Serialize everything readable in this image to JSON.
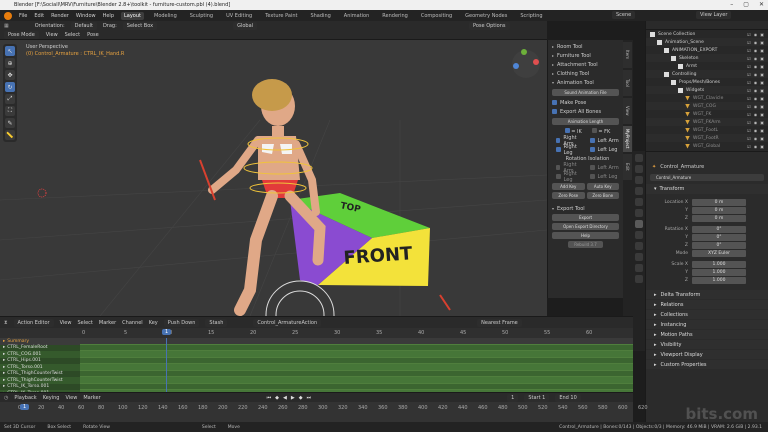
{
  "window": {
    "title": "Blender [F:\\Sociall\\MRV\\Furniture\\Blender 2.8+\\toolkit - furniture-custom.pbl (4).blend]"
  },
  "menu": [
    "File",
    "Edit",
    "Render",
    "Window",
    "Help"
  ],
  "workspaces": [
    "Layout",
    "Modeling",
    "Sculpting",
    "UV Editing",
    "Texture Paint",
    "Shading",
    "Animation",
    "Rendering",
    "Compositing",
    "Geometry Nodes",
    "Scripting"
  ],
  "active_workspace": "Layout",
  "scene": {
    "label": "Scene",
    "view_layer": "View Layer"
  },
  "viewport_header": {
    "mode": "Pose Mode",
    "view": "View",
    "select": "Select",
    "pose": "Pose",
    "orientation_label": "Orientation:",
    "orientation": "Default",
    "drag_label": "Drag:",
    "drag": "Select Box",
    "global": "Global",
    "pose_options": "Pose Options"
  },
  "viewport": {
    "perspective": "User Perspective",
    "object": "(0) Control_Armature : CTRL_IK_Hand.R",
    "box_front": "FRONT",
    "box_top": "TOP"
  },
  "npanel": {
    "tools": [
      "Room Tool",
      "Furniture Tool",
      "Attachment Tool",
      "Clothing Tool",
      "Animation Tool"
    ],
    "anim_field": "Sound Animation File",
    "make_pose": "Make Pose",
    "export_all_bones": "Export All Bones",
    "anim_length": "Animation Length",
    "ik_label": "= IK",
    "fk_label": "= FK",
    "limbs": [
      "Right Arm",
      "Left Arm",
      "Right Leg",
      "Left Leg"
    ],
    "rotation_isolation": "Rotation Isolation",
    "rot_limbs": [
      "Right Arm",
      "Left Arm",
      "Right Leg",
      "Left Leg"
    ],
    "key_buttons": [
      "Add Key",
      "Auto Key",
      "Zero Pose",
      "Zero Bone"
    ],
    "export_tool": "Export Tool",
    "export_buttons": [
      "Export",
      "Open Export Directory",
      "Help",
      "Rebuild 3.7"
    ]
  },
  "ntabs": [
    "Item",
    "Tool",
    "View",
    "MyProject",
    "Edit",
    "Edit"
  ],
  "outliner": {
    "rows": [
      {
        "name": "Scene Collection",
        "indent": 0,
        "color": "#cfcfcf"
      },
      {
        "name": "Animation_Scene",
        "indent": 1,
        "color": "#cfcfcf"
      },
      {
        "name": "ANIMATION_EXPORT",
        "indent": 2,
        "color": "#cfcfcf"
      },
      {
        "name": "Skeleton",
        "indent": 3,
        "color": "#cfcfcf"
      },
      {
        "name": "Armt",
        "indent": 4,
        "color": "#cfcfcf"
      },
      {
        "name": "Controlling",
        "indent": 2,
        "color": "#cfcfcf"
      },
      {
        "name": "Props/Mesh/Bones",
        "indent": 3,
        "color": "#cfcfcf"
      },
      {
        "name": "Widgets",
        "indent": 4,
        "color": "#cfcfcf"
      },
      {
        "name": "WGT_Clavicle",
        "indent": 5,
        "color": "#8f8f8f"
      },
      {
        "name": "WGT_COG",
        "indent": 5,
        "color": "#8f8f8f"
      },
      {
        "name": "WGT_FK",
        "indent": 5,
        "color": "#8f8f8f"
      },
      {
        "name": "WGT_FKArm",
        "indent": 5,
        "color": "#8f8f8f"
      },
      {
        "name": "WGT_FootL",
        "indent": 5,
        "color": "#8f8f8f"
      },
      {
        "name": "WGT_FootR",
        "indent": 5,
        "color": "#8f8f8f"
      },
      {
        "name": "WGT_Global",
        "indent": 5,
        "color": "#8f8f8f"
      }
    ]
  },
  "properties": {
    "object": "Control_Armature",
    "bone": "Control_Armature",
    "transform": "Transform",
    "location": {
      "label": "Location X",
      "x": "0 m",
      "y": "0 m",
      "z": "0 m"
    },
    "rotation": {
      "label": "Rotation X",
      "x": "0°",
      "y": "0°",
      "z": "0°"
    },
    "mode_label": "Mode",
    "mode": "XYZ Euler",
    "scale": {
      "label": "Scale X",
      "x": "1.000",
      "y": "1.000",
      "z": "1.000"
    },
    "sections": [
      "Delta Transform",
      "Relations",
      "Collections",
      "Instancing",
      "Motion Paths",
      "Visibility",
      "Viewport Display",
      "Custom Properties"
    ]
  },
  "action_editor": {
    "mode": "Action Editor",
    "menus": [
      "View",
      "Select",
      "Marker",
      "Channel",
      "Key"
    ],
    "push_down": "Push Down",
    "stash": "Stash",
    "action": "Control_ArmatureAction",
    "frame_mode": "Nearest Frame",
    "current_frame": "1",
    "ruler": [
      "0",
      "5",
      "10",
      "15",
      "20",
      "25",
      "30",
      "35",
      "40",
      "45",
      "50",
      "55",
      "60"
    ],
    "channels": [
      "Summary",
      "CTRL_FemaleRoot",
      "CTRL_COG.001",
      "CTRL_Hips.001",
      "CTRL_Torso.001",
      "CTRL_ThighCounterTwist",
      "CTRL_ThighCounterTwist",
      "CTRL_IK_Torso.001",
      "CTRL_IK_Torso.001"
    ]
  },
  "timeline": {
    "menus": [
      "Playback",
      "Keying",
      "View",
      "Marker"
    ],
    "ruler": [
      "0",
      "20",
      "40",
      "60",
      "80",
      "100",
      "120",
      "140",
      "160",
      "180",
      "200",
      "220",
      "240",
      "260",
      "280",
      "300",
      "320",
      "340",
      "360",
      "380",
      "400",
      "420",
      "440",
      "460",
      "480",
      "500",
      "520",
      "540",
      "560",
      "580",
      "600",
      "620"
    ],
    "current": "1",
    "start_label": "Start",
    "start": "1",
    "end_label": "End",
    "end": "10"
  },
  "statusbar": {
    "items": [
      "Set 3D Cursor",
      "Box Select",
      "Rotate View",
      "Select",
      "Move"
    ],
    "stats": "Control_Armature | Bones:0/143 | Objects:0/3 | Memory: 46.9 MiB | VRAM: 2.6 GiB | 2.93.1"
  },
  "colors": {
    "accent": "#4772b3",
    "orange": "#e87d0d",
    "green_track": "#3e6a2f",
    "box_green": "#5fcf3a",
    "box_yellow": "#f3e23a",
    "box_purple": "#8a4bd1"
  }
}
